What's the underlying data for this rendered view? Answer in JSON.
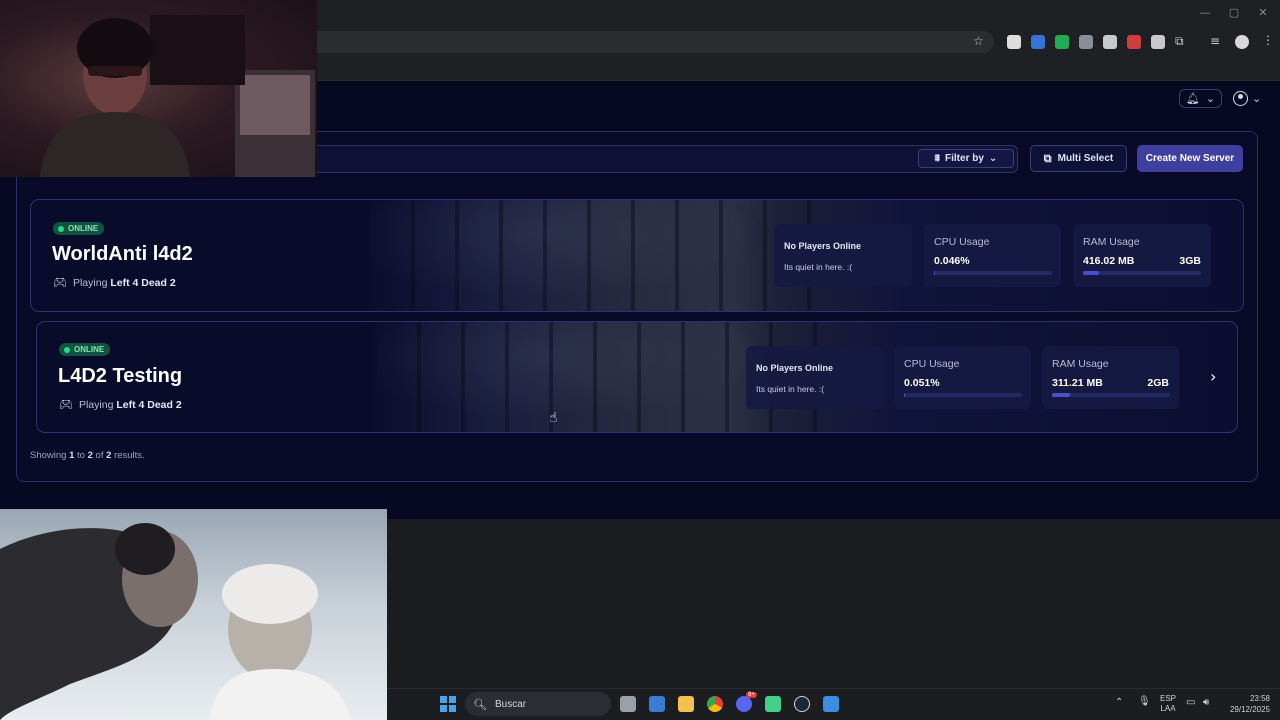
{
  "browser": {
    "window_controls": [
      "—",
      "▢",
      "✕"
    ],
    "extension_icon_colors": [
      "#ffffff",
      "#3b82f6",
      "#22c55e",
      "#9ca3af",
      "#e5e7eb",
      "#ef4444",
      "#e5e7eb",
      "#d1d5db",
      "#d1d5db",
      "#e5e7eb"
    ]
  },
  "toolbar": {
    "filter_label": "Filter by",
    "multi_select_label": "Multi Select",
    "create_label": "Create New Server"
  },
  "servers": [
    {
      "status": "ONLINE",
      "name": "WorldAnti l4d2",
      "playing_prefix": "Playing",
      "game": "Left 4 Dead 2",
      "players_title": "No Players Online",
      "players_sub": "Its quiet in here. :(",
      "cpu_title": "CPU Usage",
      "cpu_value": "0.046%",
      "cpu_fraction": 0.0046,
      "ram_title": "RAM Usage",
      "ram_value": "416.02 MB",
      "ram_total": "3GB",
      "ram_fraction": 0.135
    },
    {
      "status": "ONLINE",
      "name": "L4D2 Testing",
      "playing_prefix": "Playing",
      "game": "Left 4 Dead 2",
      "players_title": "No Players Online",
      "players_sub": "Its quiet in here. :(",
      "cpu_title": "CPU Usage",
      "cpu_value": "0.051%",
      "cpu_fraction": 0.0051,
      "ram_title": "RAM Usage",
      "ram_value": "311.21 MB",
      "ram_total": "2GB",
      "ram_fraction": 0.152
    }
  ],
  "pagination": {
    "prefix": "Showing",
    "from": "1",
    "to_word": "to",
    "to": "2",
    "of_word": "of",
    "total": "2",
    "suffix": "results."
  },
  "taskbar": {
    "search_label": "Buscar",
    "lang_line1": "ESP",
    "lang_line2": "LAA",
    "time": "23:58",
    "date": "29/12/2025",
    "discord_badge": "9+"
  },
  "colors": {
    "app_bg": "#070822",
    "accent": "#3f3fa0",
    "online_green": "#2fd48d",
    "bar_fill": "#4a4fd0"
  }
}
